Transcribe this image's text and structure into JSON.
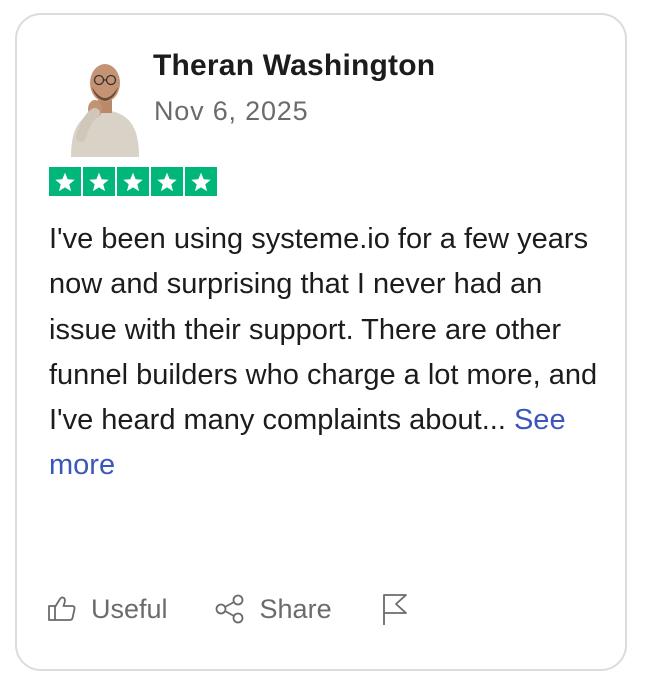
{
  "reviewer": {
    "name": "Theran Washington",
    "date": "Nov 6, 2025",
    "avatar_icon": "user-photo"
  },
  "rating": {
    "stars": 5,
    "max": 5,
    "color": "#00b67a"
  },
  "review": {
    "text": "I've been using systeme.io for a few years now and surprising that I never had an issue with their support. There are other funnel builders who charge a lot more, and I've heard many complaints about...",
    "see_more_label": "See more",
    "link_color": "#3c57bc"
  },
  "actions": {
    "useful_label": "Useful",
    "useful_icon": "thumbs-up-icon",
    "share_label": "Share",
    "share_icon": "share-icon",
    "report_icon": "flag-icon"
  }
}
